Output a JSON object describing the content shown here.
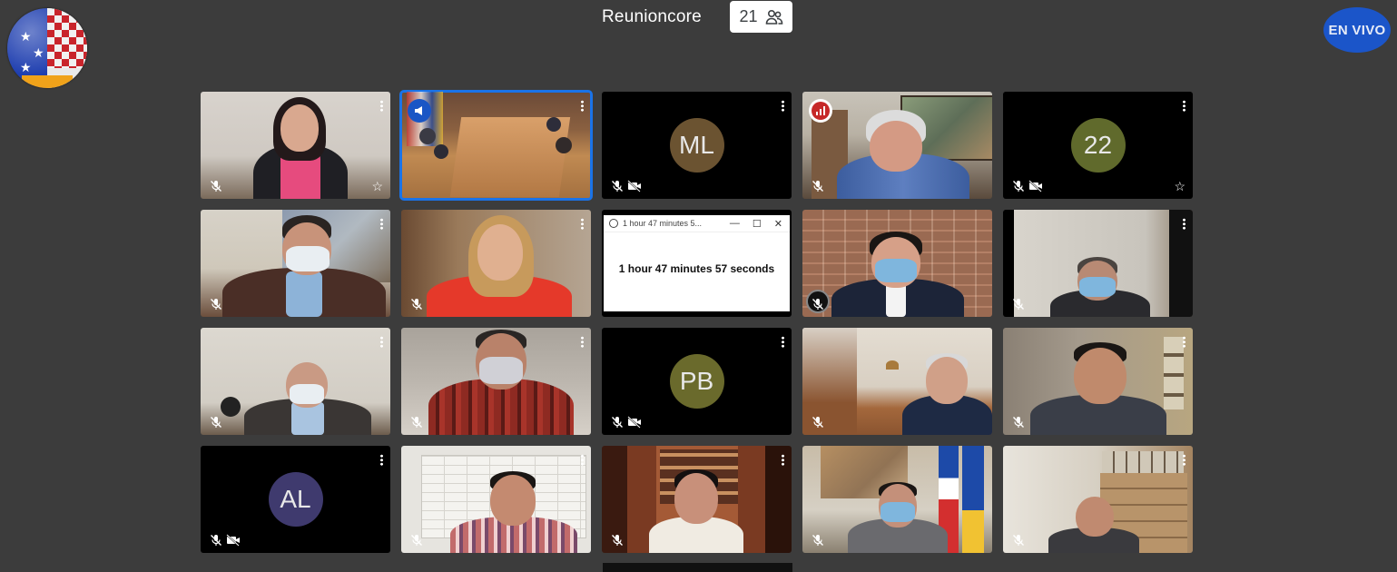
{
  "meeting": {
    "title": "Reunioncore",
    "participant_count": "21",
    "live_label": "EN VIVO"
  },
  "tiles": [
    {
      "id": "t1",
      "avatar": "",
      "mic_off": true,
      "cam_off": false,
      "pinned": true
    },
    {
      "id": "t2",
      "avatar": "",
      "mic_off": false,
      "cam_off": false,
      "active": true
    },
    {
      "id": "t3",
      "avatar": "ML",
      "mic_off": true,
      "cam_off": true,
      "avatar_color": "#6b5331"
    },
    {
      "id": "t4",
      "avatar": "",
      "mic_off": true,
      "cam_off": false,
      "speaking": true
    },
    {
      "id": "t5",
      "avatar": "22",
      "mic_off": true,
      "cam_off": true,
      "pinned": true,
      "avatar_color": "#606a2c"
    },
    {
      "id": "t6",
      "avatar": "",
      "mic_off": true,
      "cam_off": false
    },
    {
      "id": "t7",
      "avatar": "",
      "mic_off": true,
      "cam_off": false
    },
    {
      "id": "t8",
      "avatar": "",
      "mic_off": false,
      "cam_off": false
    },
    {
      "id": "t9",
      "avatar": "",
      "mic_off": true,
      "cam_off": false
    },
    {
      "id": "t10",
      "avatar": "",
      "mic_off": true,
      "cam_off": false
    },
    {
      "id": "t11",
      "avatar": "",
      "mic_off": true,
      "cam_off": false
    },
    {
      "id": "t12",
      "avatar": "",
      "mic_off": true,
      "cam_off": false
    },
    {
      "id": "t13",
      "avatar": "PB",
      "mic_off": true,
      "cam_off": true,
      "avatar_color": "#6a6a2c"
    },
    {
      "id": "t14",
      "avatar": "",
      "mic_off": true,
      "cam_off": false
    },
    {
      "id": "t15",
      "avatar": "",
      "mic_off": true,
      "cam_off": false
    },
    {
      "id": "t16",
      "avatar": "AL",
      "mic_off": true,
      "cam_off": true,
      "avatar_color": "#3f3a6e"
    },
    {
      "id": "t17",
      "avatar": "",
      "mic_off": true,
      "cam_off": false
    },
    {
      "id": "t18",
      "avatar": "",
      "mic_off": true,
      "cam_off": false
    },
    {
      "id": "t19",
      "avatar": "",
      "mic_off": true,
      "cam_off": false
    },
    {
      "id": "t20",
      "avatar": "",
      "mic_off": true,
      "cam_off": false
    }
  ],
  "timer_window": {
    "titlebar": "1 hour 47 minutes 5...",
    "text": "1 hour 47 minutes 57 seconds",
    "controls": [
      "—",
      "☐",
      "✕"
    ]
  },
  "colors": {
    "background": "#3c3c3c",
    "active_border": "#1a73e8",
    "live_badge": "#1b55c9"
  }
}
